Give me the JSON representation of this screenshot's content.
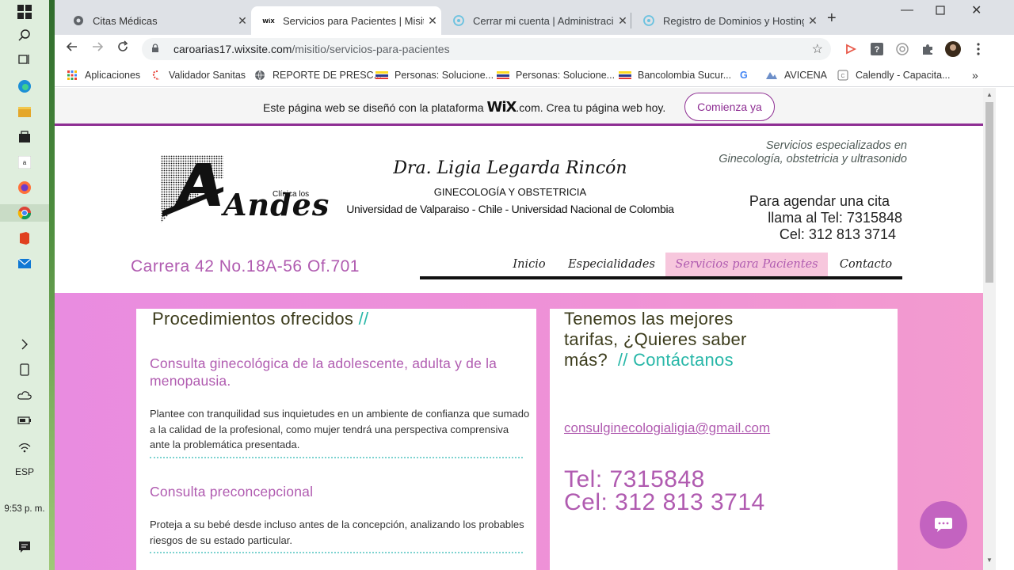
{
  "taskbar": {
    "language": "ESP",
    "time": "9:53 p. m."
  },
  "tabs": [
    {
      "label": "Citas Médicas",
      "icon": "globe-icon"
    },
    {
      "label": "Servicios para Pacientes | Misitio",
      "icon": "wix-icon"
    },
    {
      "label": "Cerrar mi cuenta | Administración",
      "icon": "hostinger-icon"
    },
    {
      "label": "Registro de Dominios y Hosting e",
      "icon": "hostinger-icon"
    }
  ],
  "address_bar": {
    "domain": "caroarias17.wixsite.com",
    "path": "/misitio/servicios-para-pacientes"
  },
  "bookmarks": [
    {
      "label": "Aplicaciones"
    },
    {
      "label": "Validador Sanitas"
    },
    {
      "label": "REPORTE DE PRESC..."
    },
    {
      "label": "Personas: Solucione..."
    },
    {
      "label": "Personas: Solucione..."
    },
    {
      "label": "Bancolombia Sucur..."
    },
    {
      "label": "G"
    },
    {
      "label": "AVICENA"
    },
    {
      "label": "Calendly - Capacita..."
    }
  ],
  "wix_banner": {
    "text_before": "Este página web se diseñó con la plataforma ",
    "logo": "WiX",
    "text_after": ".com. Crea tu página web hoy.",
    "cta": "Comienza ya"
  },
  "header": {
    "logo_small": "Clínica los",
    "logo_big": "Andes",
    "doctor_name": "Dra. Ligia Legarda Rincón",
    "specialty": "GINECOLOGÍA Y OBSTETRICIA",
    "universities": "Universidad de Valparaiso - Chile - Universidad Nacional de Colombia",
    "tagline_1": "Servicios especializados en",
    "tagline_2": "Ginecología, obstetricia y ultrasonido",
    "agenda_1": "Para agendar una cita",
    "agenda_2": "llama al Tel: 7315848",
    "agenda_3": "Cel: 312 813 3714",
    "address": "Carrera 42 No.18A-56 Of.701"
  },
  "nav": [
    {
      "label": "Inicio"
    },
    {
      "label": "Especialidades"
    },
    {
      "label": "Servicios para Pacientes"
    },
    {
      "label": "Contacto"
    }
  ],
  "left_card": {
    "title": "Procedimientos ofrecidos ",
    "title_accent": "//",
    "services": [
      {
        "title": "Consulta ginecológica de la adolescente, adulta y de la menopausia.",
        "description": "Plantee con tranquilidad sus inquietudes en un ambiente de confianza que sumado a la calidad de la profesional, como mujer tendrá una perspectiva comprensiva ante la problemática presentada."
      },
      {
        "title": "Consulta preconcepcional",
        "description": "Proteja a su bebé desde incluso antes de la concepción, analizando los probables riesgos de su estado particular."
      }
    ]
  },
  "right_card": {
    "title_1": "Tenemos las mejores",
    "title_2": "tarifas, ¿Quieres saber",
    "title_3": "más?  ",
    "title_accent": "// Contáctanos",
    "email": "consulginecologialigia@gmail.com",
    "tel": "Tel: 7315848",
    "cel": "Cel: 312 813 3714"
  }
}
